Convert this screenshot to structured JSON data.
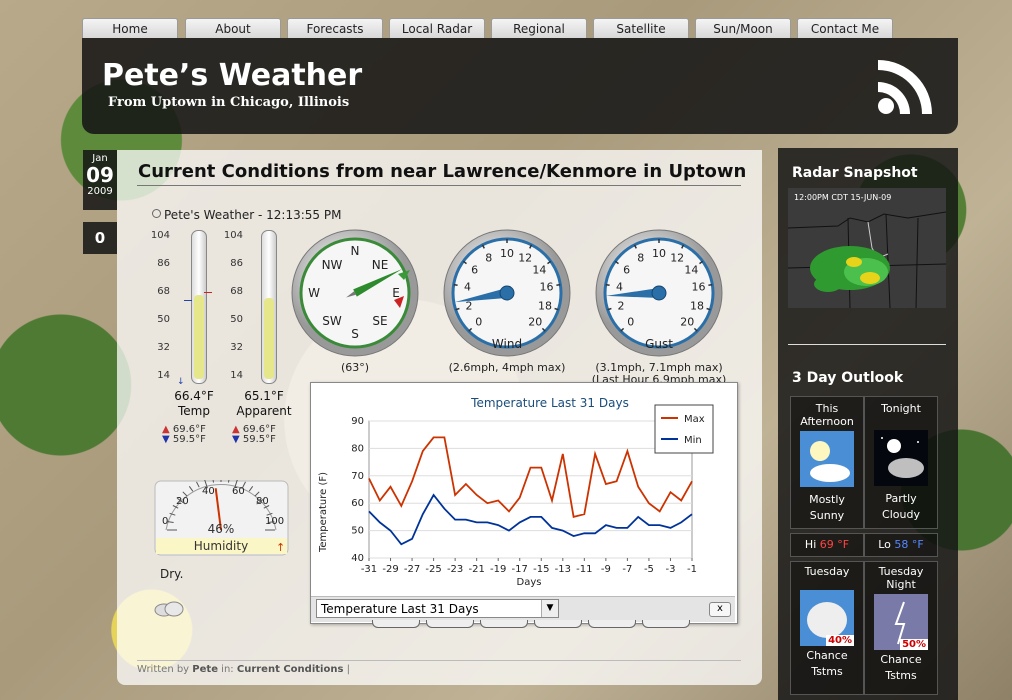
{
  "nav": [
    "Home",
    "About",
    "Forecasts",
    "Local Radar",
    "Regional",
    "Satellite",
    "Sun/Moon",
    "Contact Me"
  ],
  "site": {
    "title": "Pete’s Weather",
    "subtitle": "From Uptown in Chicago, Illinois"
  },
  "date": {
    "month": "Jan",
    "day": "09",
    "year": "2009"
  },
  "comments": "0",
  "post": {
    "title": "Current Conditions from near Lawrence/Kenmore in Uptown",
    "station": "Pete's Weather - 12:13:55 PM",
    "thermo_ticks": [
      "104",
      "86",
      "68",
      "50",
      "32",
      "14"
    ],
    "temp": {
      "reading": "66.4°F",
      "label": "Temp",
      "max": "69.6°F",
      "min": "59.5°F",
      "level": 0.6
    },
    "apparent": {
      "reading": "65.1°F",
      "label": "Apparent",
      "max": "69.6°F",
      "min": "59.5°F",
      "level": 0.58
    },
    "compass": {
      "labels": [
        "N",
        "NE",
        "E",
        "SE",
        "S",
        "SW",
        "W",
        "NW"
      ],
      "caption": "(63°)",
      "direction_deg": 63
    },
    "wind": {
      "label": "Wind",
      "ticks": [
        "0",
        "2",
        "4",
        "6",
        "8",
        "10",
        "12",
        "14",
        "16",
        "18",
        "20"
      ],
      "caption": "(2.6mph, 4mph max)",
      "value": 2.6
    },
    "gust": {
      "label": "Gust",
      "ticks": [
        "0",
        "2",
        "4",
        "6",
        "8",
        "10",
        "12",
        "14",
        "16",
        "18",
        "20"
      ],
      "caption1": "(3.1mph, 7.1mph max)",
      "caption2": "(Last Hour 6.9mph max)",
      "value": 3.1
    },
    "humidity": {
      "ticks": [
        "0",
        "20",
        "40",
        "60",
        "80",
        "100"
      ],
      "value_text": "46%",
      "label": "Humidity",
      "value": 46
    },
    "condition": "Dry.",
    "footer": {
      "prefix": "Written by",
      "author": "Pete",
      "mid": "in:",
      "category": "Current Conditions",
      "suffix": "|"
    }
  },
  "chart_data": {
    "type": "line",
    "title": "Temperature Last 31 Days",
    "xlabel": "Days",
    "ylabel": "Temperature (F)",
    "x": [
      -31,
      -30,
      -29,
      -28,
      -27,
      -26,
      -25,
      -24,
      -23,
      -22,
      -21,
      -20,
      -19,
      -18,
      -17,
      -16,
      -15,
      -14,
      -13,
      -12,
      -11,
      -10,
      -9,
      -8,
      -7,
      -6,
      -5,
      -4,
      -3,
      -2,
      -1
    ],
    "xticks": [
      "-31",
      "-29",
      "-27",
      "-25",
      "-23",
      "-21",
      "-19",
      "-17",
      "-15",
      "-13",
      "-11",
      "-9",
      "-7",
      "-5",
      "-3",
      "-1"
    ],
    "yticks": [
      "40",
      "50",
      "60",
      "70",
      "80",
      "90"
    ],
    "ylim": [
      40,
      90
    ],
    "series": [
      {
        "name": "Max",
        "color": "#cc3300",
        "values": [
          69,
          61,
          66,
          59,
          68,
          79,
          84,
          84,
          63,
          67,
          63,
          60,
          61,
          57,
          62,
          73,
          73,
          61,
          78,
          55,
          56,
          78,
          67,
          68,
          79,
          66,
          60,
          57,
          64,
          61,
          68
        ]
      },
      {
        "name": "Min",
        "color": "#003399",
        "values": [
          57,
          53,
          50,
          45,
          47,
          56,
          63,
          58,
          54,
          54,
          53,
          53,
          52,
          50,
          53,
          55,
          55,
          51,
          50,
          48,
          49,
          49,
          52,
          51,
          51,
          55,
          52,
          52,
          51,
          53,
          56
        ]
      }
    ],
    "legend": "top-right"
  },
  "popup": {
    "select_value": "Temperature Last 31 Days",
    "close": "x"
  },
  "sidebar": {
    "radar_title": "Radar Snapshot",
    "radar_stamp": "12:00PM CDT 15-JUN-09",
    "outlook_title": "3 Day Outlook",
    "periods": [
      {
        "name1": "This",
        "name2": "Afternoon",
        "desc1": "Mostly",
        "desc2": "Sunny",
        "icon": "sun-cloud-icon"
      },
      {
        "name1": "Tonight",
        "name2": "",
        "desc1": "Partly",
        "desc2": "Cloudy",
        "icon": "moon-cloud-icon"
      },
      {
        "name1": "Tuesday",
        "name2": "",
        "desc1": "Chance",
        "desc2": "Tstms",
        "pop": "40%",
        "icon": "storm-icon"
      },
      {
        "name1": "Tuesday",
        "name2": "Night",
        "desc1": "Chance",
        "desc2": "Tstms",
        "pop": "50%",
        "icon": "lightning-icon"
      }
    ],
    "hi": {
      "label": "Hi",
      "value": "69 °F",
      "color": "#ff4444"
    },
    "lo": {
      "label": "Lo",
      "value": "58 °F",
      "color": "#5588ff"
    }
  }
}
